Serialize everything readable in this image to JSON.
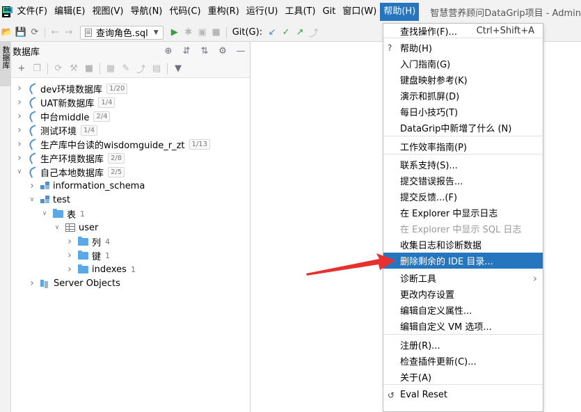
{
  "menubar": {
    "items": [
      "文件(F)",
      "编辑(E)",
      "视图(V)",
      "导航(N)",
      "代码(C)",
      "重构(R)",
      "运行(U)",
      "工具(T)",
      "Git",
      "窗口(W)",
      "帮助(H)"
    ],
    "active_index": 10,
    "window_title": "智慧营养顾问DataGrip项目 - Admin"
  },
  "toolbar": {
    "run_config": "查询角色.sql",
    "git_label": "Git(G):"
  },
  "side_tab": {
    "label": "数据库"
  },
  "db_panel": {
    "title": "数据库",
    "tree": [
      {
        "label": "dev环境数据库",
        "badge": "1/20",
        "depth": 0,
        "expanded": false,
        "icon": "mysql-icon"
      },
      {
        "label": "UAT新数据库",
        "badge": "1/4",
        "depth": 0,
        "expanded": false,
        "icon": "mysql-icon"
      },
      {
        "label": "中台middle",
        "badge": "2/4",
        "depth": 0,
        "expanded": false,
        "icon": "mysql-icon"
      },
      {
        "label": "测试环境",
        "badge": "1/4",
        "depth": 0,
        "expanded": false,
        "icon": "mysql-icon"
      },
      {
        "label": "生产库中台读的wisdomguide_r_zt",
        "badge": "1/13",
        "depth": 0,
        "expanded": false,
        "icon": "mysql-icon"
      },
      {
        "label": "生产环境数据库",
        "badge": "2/8",
        "depth": 0,
        "expanded": false,
        "icon": "mysql-icon"
      },
      {
        "label": "自己本地数据库",
        "badge": "2/5",
        "depth": 0,
        "expanded": true,
        "icon": "mysql-icon"
      },
      {
        "label": "information_schema",
        "count": "",
        "depth": 1,
        "expanded": false,
        "icon": "schema-icon"
      },
      {
        "label": "test",
        "count": "",
        "depth": 1,
        "expanded": true,
        "icon": "schema-icon"
      },
      {
        "label": "表",
        "count": "1",
        "depth": 2,
        "expanded": true,
        "icon": "folder-icon"
      },
      {
        "label": "user",
        "count": "",
        "depth": 3,
        "expanded": true,
        "icon": "table-icon"
      },
      {
        "label": "列",
        "count": "4",
        "depth": 4,
        "expanded": false,
        "icon": "folder-icon"
      },
      {
        "label": "键",
        "count": "1",
        "depth": 4,
        "expanded": false,
        "icon": "folder-icon"
      },
      {
        "label": "indexes",
        "count": "1",
        "depth": 4,
        "expanded": false,
        "icon": "folder-icon"
      },
      {
        "label": "Server Objects",
        "count": "",
        "depth": 1,
        "expanded": false,
        "icon": "server-objects-icon"
      }
    ]
  },
  "help_menu": {
    "items": [
      {
        "label": "查找操作(F)...",
        "shortcut": "Ctrl+Shift+A"
      },
      {
        "label": "帮助(H)",
        "lead": "?"
      },
      {
        "label": "入门指南(G)"
      },
      {
        "label": "键盘映射参考(K)"
      },
      {
        "label": "演示和抓屏(D)"
      },
      {
        "label": "每日小技巧(T)"
      },
      {
        "label": "DataGrip中新增了什么 (N)"
      },
      {
        "label": "工作效率指南(P)"
      },
      {
        "label": "联系支持(S)..."
      },
      {
        "label": "提交错误报告..."
      },
      {
        "label": "提交反馈...(F)"
      },
      {
        "label": "在 Explorer 中显示日志"
      },
      {
        "label": "在 Explorer 中显示 SQL 日志",
        "disabled": true
      },
      {
        "label": "收集日志和诊断数据"
      },
      {
        "label": "删除剩余的 IDE 目录...",
        "highlighted": true
      },
      {
        "label": "诊断工具",
        "submenu": true
      },
      {
        "label": "更改内存设置"
      },
      {
        "label": "编辑自定义属性..."
      },
      {
        "label": "编辑自定义 VM 选项..."
      },
      {
        "label": "注册(R)..."
      },
      {
        "label": "检查插件更新(C)..."
      },
      {
        "label": "关于(A)"
      },
      {
        "label": "Eval Reset",
        "lead": "↺"
      }
    ]
  },
  "colors": {
    "accent": "#2675bf",
    "annotation_arrow": "#e8312f"
  }
}
